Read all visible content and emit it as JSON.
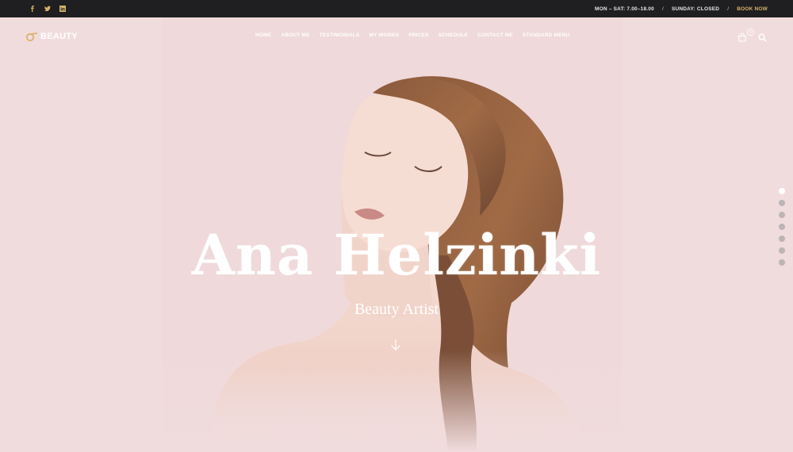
{
  "topbar": {
    "social": [
      {
        "icon": "facebook-icon"
      },
      {
        "icon": "twitter-icon"
      },
      {
        "icon": "linkedin-icon"
      }
    ],
    "hours_weekdays": "MON – SAT: 7.00–18.00",
    "separator": "/",
    "hours_sunday": "SUNDAY: CLOSED",
    "book_now": "BOOK NOW"
  },
  "header": {
    "logo_text": "BEAUTY",
    "nav": [
      "HOME",
      "ABOUT ME",
      "TESTIMONIALS",
      "MY WORKS",
      "PRICES",
      "SCHEDULE",
      "CONTACT ME",
      "STANDARD MENU"
    ],
    "cart_count": "0"
  },
  "hero": {
    "title": "Ana Helzinki",
    "subtitle": "Beauty Artist"
  },
  "slider": {
    "dot_count": 7,
    "active_index": 0
  },
  "colors": {
    "background": "#f1dcdd",
    "topbar": "#1f1f21",
    "accent": "#d8b36a"
  }
}
